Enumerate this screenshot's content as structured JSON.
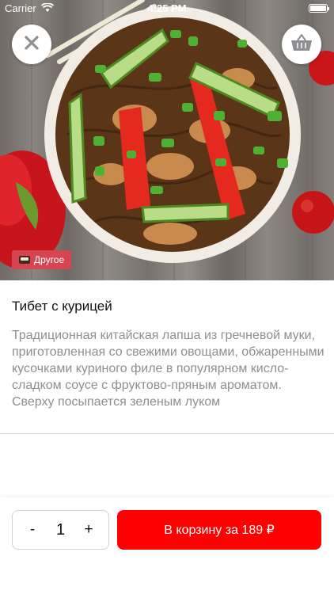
{
  "status_bar": {
    "carrier": "Carrier",
    "time": "4:25 PM"
  },
  "header": {
    "close_icon": "close-icon",
    "basket_icon": "basket-icon"
  },
  "product": {
    "category_badge": "Другое",
    "category_emoji": "bento-box-icon",
    "title": "Тибет с курицей",
    "description": "Традиционная китайская лапша из гречневой муки, приготовленная со свежими овощами, обжаренными кусочками куриного филе в популярном кисло-сладком соусе с фруктово-пряным ароматом. Сверху посыпается зеленым луком"
  },
  "order": {
    "minus": "-",
    "quantity": "1",
    "plus": "+",
    "add_to_cart": "В корзину за 189 ₽"
  },
  "colors": {
    "accent": "#ff0000",
    "badge": "#d64652",
    "description_text": "#8e8e93"
  }
}
